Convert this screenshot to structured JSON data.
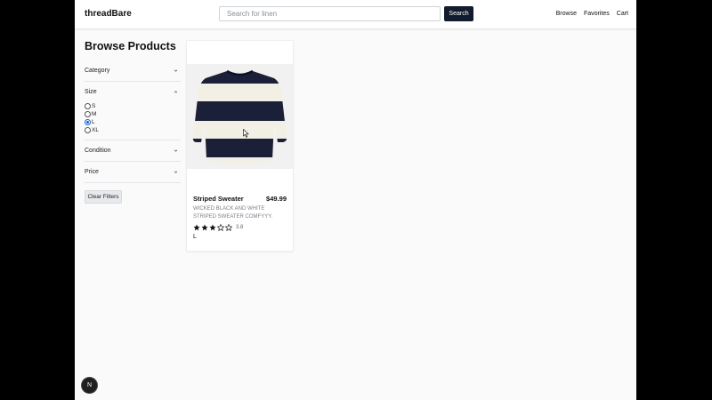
{
  "header": {
    "brand": "threadBare",
    "search_placeholder": "Search for linen",
    "search_button": "Search",
    "nav": [
      "Browse",
      "Favorites",
      "Cart"
    ]
  },
  "sidebar": {
    "title": "Browse Products",
    "filters": {
      "category": "Category",
      "size": "Size",
      "condition": "Condition",
      "price": "Price"
    },
    "size_options": [
      "S",
      "M",
      "L",
      "XL"
    ],
    "selected_size": "L",
    "clear_button": "Clear Filters"
  },
  "product": {
    "name": "Striped Sweater",
    "price": "$49.99",
    "description": "WICKED BLACK AND WHITE STRIPED SWEATER COMFYYY.",
    "rating": 3.8,
    "rating_label": "3.8",
    "size": "L"
  },
  "badge": "N",
  "colors": {
    "button_dark": "#131b2e",
    "page_bg": "#fafafb",
    "sweater_dark": "#1b1f38",
    "sweater_light": "#f2efe5"
  }
}
